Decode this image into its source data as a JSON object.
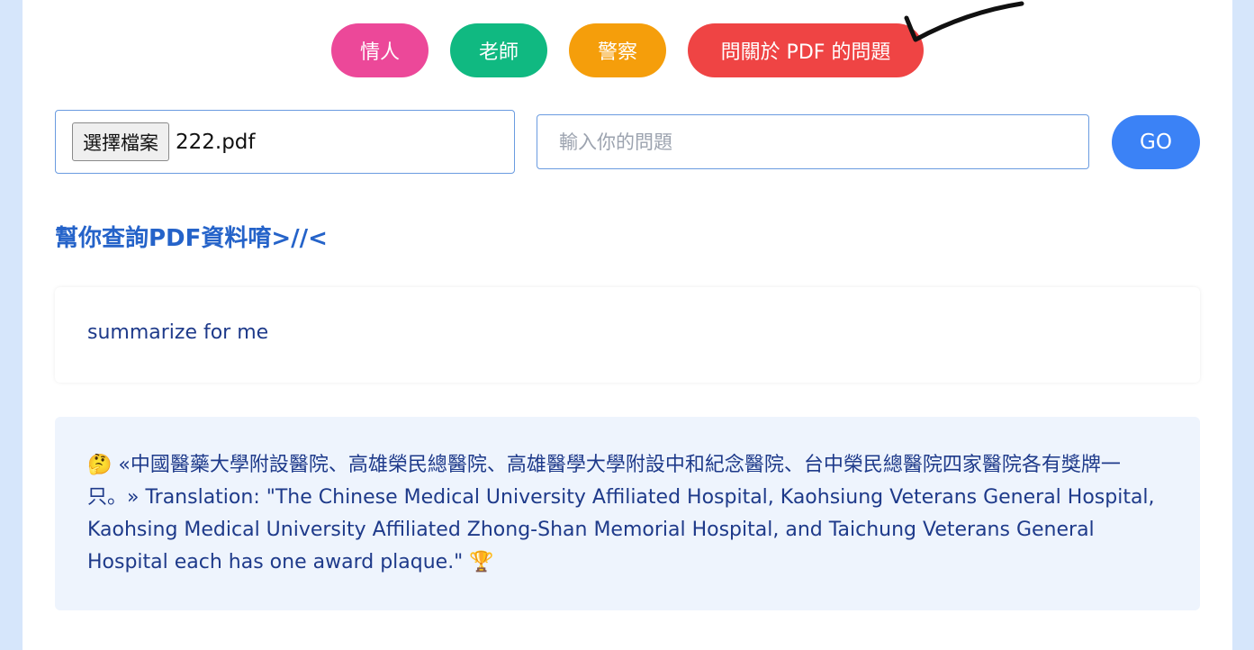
{
  "modes": {
    "lover": "情人",
    "teacher": "老師",
    "police": "警察",
    "pdf": "問關於 PDF 的問題"
  },
  "file_input": {
    "button_label": "選擇檔案",
    "file_name": "222.pdf"
  },
  "question_input": {
    "placeholder": "輸入你的問題",
    "value": ""
  },
  "go_button": "GO",
  "heading": "幫你查詢PDF資料唷>//<",
  "query": "summarize for me",
  "answer": "🤔 «中國醫藥大學附設醫院、高雄榮民總醫院、高雄醫學大學附設中和紀念醫院、台中榮民總醫院四家醫院各有獎牌一只。» Translation: \"The Chinese Medical University Affiliated Hospital, Kaohsiung Veterans General Hospital, Kaohsing Medical University Affiliated Zhong-Shan Memorial Hospital, and Taichung Veterans General Hospital each has one award plaque.\" 🏆",
  "colors": {
    "lover": "#ec4899",
    "teacher": "#10b981",
    "police": "#f59e0b",
    "pdf": "#ef4444",
    "go": "#3b82f6",
    "heading": "#2563c9",
    "text": "#1e3a8a",
    "background": "#d6e6fb"
  }
}
